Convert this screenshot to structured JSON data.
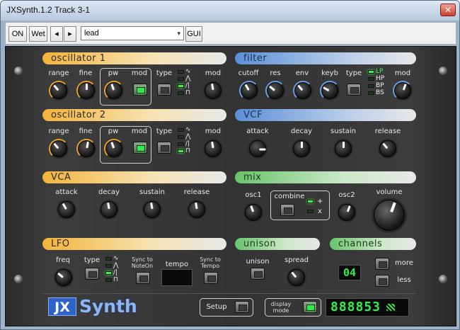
{
  "window": {
    "title": "JXSynth.1.2  Track 3-1",
    "close_glyph": "✕"
  },
  "toolbar": {
    "on": "ON",
    "wet": "Wet",
    "prev": "◂",
    "next": "▸",
    "preset": "lead",
    "gui": "GUI",
    "dropdown_arrow": "▾"
  },
  "osc1": {
    "title": "oscillator 1",
    "range": "range",
    "fine": "fine",
    "pw": "pw",
    "mod": "mod",
    "type": "type",
    "mod2": "mod",
    "waveforms": [
      "∿",
      "⋀",
      "/|",
      "⊓"
    ],
    "active_wave": 2
  },
  "osc2": {
    "title": "oscillator 2",
    "range": "range",
    "fine": "fine",
    "pw": "pw",
    "mod": "mod",
    "type": "type",
    "mod2": "mod",
    "waveforms": [
      "∿",
      "⋀",
      "/|",
      "⊓"
    ],
    "active_wave": 3
  },
  "filter": {
    "title": "filter",
    "cutoff": "cutoff",
    "res": "res",
    "env": "env",
    "keyb": "keyb",
    "type": "type",
    "mod": "mod",
    "types": [
      "LP",
      "HP",
      "BP",
      "BS"
    ],
    "active_type": 0
  },
  "vcf": {
    "title": "VCF",
    "attack": "attack",
    "decay": "decay",
    "sustain": "sustain",
    "release": "release"
  },
  "vca": {
    "title": "VCA",
    "attack": "attack",
    "decay": "decay",
    "sustain": "sustain",
    "release": "release"
  },
  "mix": {
    "title": "mix",
    "osc1": "osc1",
    "combine": "combine",
    "plus": "+",
    "x": "x",
    "osc2": "osc2",
    "volume": "volume"
  },
  "lfo": {
    "title": "LFO",
    "freq": "freq",
    "type": "type",
    "sync_note_1": "Sync to",
    "sync_note_2": "NoteOn",
    "tempo": "tempo",
    "sync_tempo_1": "Sync to",
    "sync_tempo_2": "Tempo",
    "waveforms": [
      "∿",
      "⋀",
      "/|",
      "⊓"
    ],
    "active_wave": 2
  },
  "unison": {
    "title": "unison",
    "unison": "unison",
    "spread": "spread"
  },
  "channels": {
    "title": "channels",
    "value": "04",
    "more": "more",
    "less": "less"
  },
  "bottom": {
    "logo_jx": "JX",
    "logo_synth": "Synth",
    "setup": "Setup",
    "display_1": "display",
    "display_2": "mode",
    "display_value": "888853"
  },
  "colors": {
    "orange": "#f3b33a",
    "blue": "#5a8fd6",
    "green": "#67c46b",
    "led": "#3ff050"
  }
}
